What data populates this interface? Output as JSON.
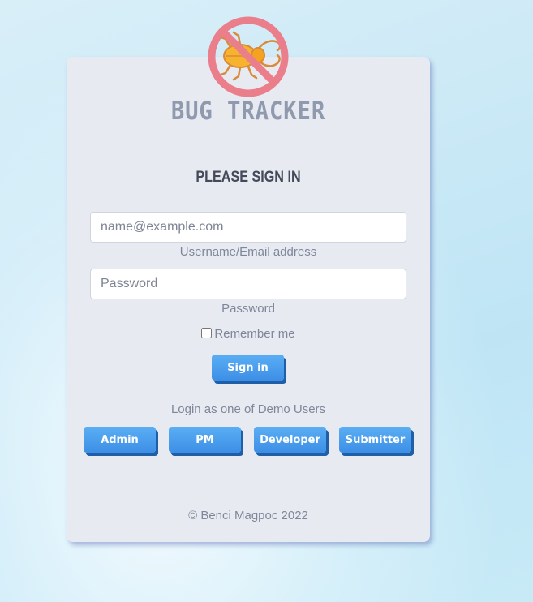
{
  "app": {
    "title": "BUG TRACKER",
    "logo_icon": "no-bugs-icon"
  },
  "form": {
    "heading": "PLEASE SIGN IN",
    "email_placeholder": "name@example.com",
    "email_value": "",
    "email_label": "Username/Email address",
    "password_placeholder": "Password",
    "password_value": "",
    "password_label": "Password",
    "remember_label": "Remember me",
    "remember_checked": false,
    "submit_label": "Sign in"
  },
  "demo": {
    "heading": "Login as one of Demo Users",
    "buttons": [
      "Admin",
      "PM",
      "Developer",
      "Submitter"
    ]
  },
  "footer": {
    "copyright": "© Benci Magpoc 2022"
  },
  "colors": {
    "button_blue": "#4a9cee",
    "button_shadow": "#1f5fa8",
    "card_bg": "#e8eaf1",
    "title_gray": "#8f9aae",
    "prohibition_red": "#ea7f8b",
    "beetle_orange": "#f7b22e"
  }
}
